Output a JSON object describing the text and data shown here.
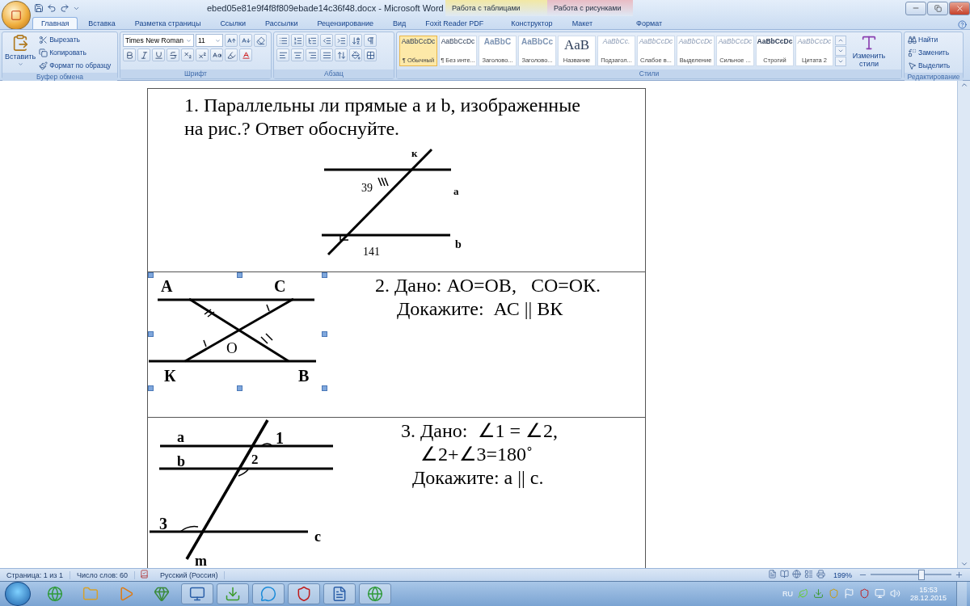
{
  "window": {
    "title": "ebed05e81e9f4f8f809ebade14c36f48.docx - Microsoft Word",
    "context_tabs": [
      {
        "label": "Работа с таблицами",
        "color": "#f2e8a4"
      },
      {
        "label": "Работа с рисунками",
        "color": "#e9bcc4"
      }
    ]
  },
  "tabs": [
    {
      "label": "Главная",
      "selected": true
    },
    {
      "label": "Вставка",
      "selected": false
    },
    {
      "label": "Разметка страницы",
      "selected": false
    },
    {
      "label": "Ссылки",
      "selected": false
    },
    {
      "label": "Рассылки",
      "selected": false
    },
    {
      "label": "Рецензирование",
      "selected": false
    },
    {
      "label": "Вид",
      "selected": false
    },
    {
      "label": "Foxit Reader PDF",
      "selected": false
    },
    {
      "label": "Конструктор",
      "selected": false
    },
    {
      "label": "Макет",
      "selected": false
    },
    {
      "label": "Формат",
      "selected": false
    }
  ],
  "ribbon": {
    "clipboard": {
      "title": "Буфер обмена",
      "paste": "Вставить",
      "items": [
        "Вырезать",
        "Копировать",
        "Формат по образцу"
      ]
    },
    "font": {
      "title": "Шрифт",
      "font_name": "Times New Roman",
      "font_size": "11"
    },
    "paragraph": {
      "title": "Абзац"
    },
    "styles": {
      "title": "Стили",
      "change": "Изменить стили",
      "items": [
        {
          "preview": "AaBbCcDc",
          "name": "¶ Обычный",
          "kind": "plain",
          "selected": true
        },
        {
          "preview": "AaBbCcDc",
          "name": "¶ Без инте...",
          "kind": "plain",
          "selected": false
        },
        {
          "preview": "AaBbC",
          "name": "Заголово...",
          "kind": "heading",
          "selected": false
        },
        {
          "preview": "AaBbCc",
          "name": "Заголово...",
          "kind": "heading",
          "selected": false
        },
        {
          "preview": "AaB",
          "name": "Название",
          "kind": "title",
          "selected": false
        },
        {
          "preview": "AaBbCc.",
          "name": "Подзагол...",
          "kind": "italic",
          "selected": false
        },
        {
          "preview": "AaBbCcDc",
          "name": "Слабое в...",
          "kind": "italic",
          "selected": false
        },
        {
          "preview": "AaBbCcDc",
          "name": "Выделение",
          "kind": "italic",
          "selected": false
        },
        {
          "preview": "AaBbCcDc",
          "name": "Сильное ...",
          "kind": "italic",
          "selected": false
        },
        {
          "preview": "AaBbCcDc",
          "name": "Строгий",
          "kind": "strong",
          "selected": false
        },
        {
          "preview": "AaBbCcDc",
          "name": "Цитата 2",
          "kind": "italic",
          "selected": false
        }
      ]
    },
    "editing": {
      "title": "Редактирование",
      "items": [
        "Найти",
        "Заменить",
        "Выделить"
      ]
    }
  },
  "document": {
    "rows": [
      {
        "kind": "top",
        "lines": [
          "1. Параллельны ли прямые a и b, изображенные",
          "на рис.? Ответ обоснуйте."
        ],
        "figure": {
          "labels": [
            "к",
            "39",
            "a",
            "b",
            "141"
          ],
          "selected": false
        }
      },
      {
        "kind": "side",
        "lines": [
          "2. Дано: АО=ОВ,   СО=ОК.",
          "Докажите:  АС || ВК"
        ],
        "figure": {
          "labels": [
            "А",
            "С",
            "О",
            "К",
            "В"
          ],
          "selected": true
        }
      },
      {
        "kind": "side",
        "lines": [
          "3. Дано:  ∠1 = ∠2,",
          "∠2+∠3=180˚",
          "Докажите: a || c."
        ],
        "figure": {
          "labels": [
            "a",
            "b",
            "1",
            "2",
            "3",
            "c",
            "m"
          ],
          "selected": false
        }
      }
    ]
  },
  "status_bar": {
    "items": [
      "Страница: 1 из 1",
      "Число слов: 60",
      "Русский (Россия)"
    ],
    "zoom": "199%",
    "level": 0.62
  },
  "taskbar": {
    "language": "RU",
    "time": "15:53",
    "date": "28.12.2015"
  }
}
